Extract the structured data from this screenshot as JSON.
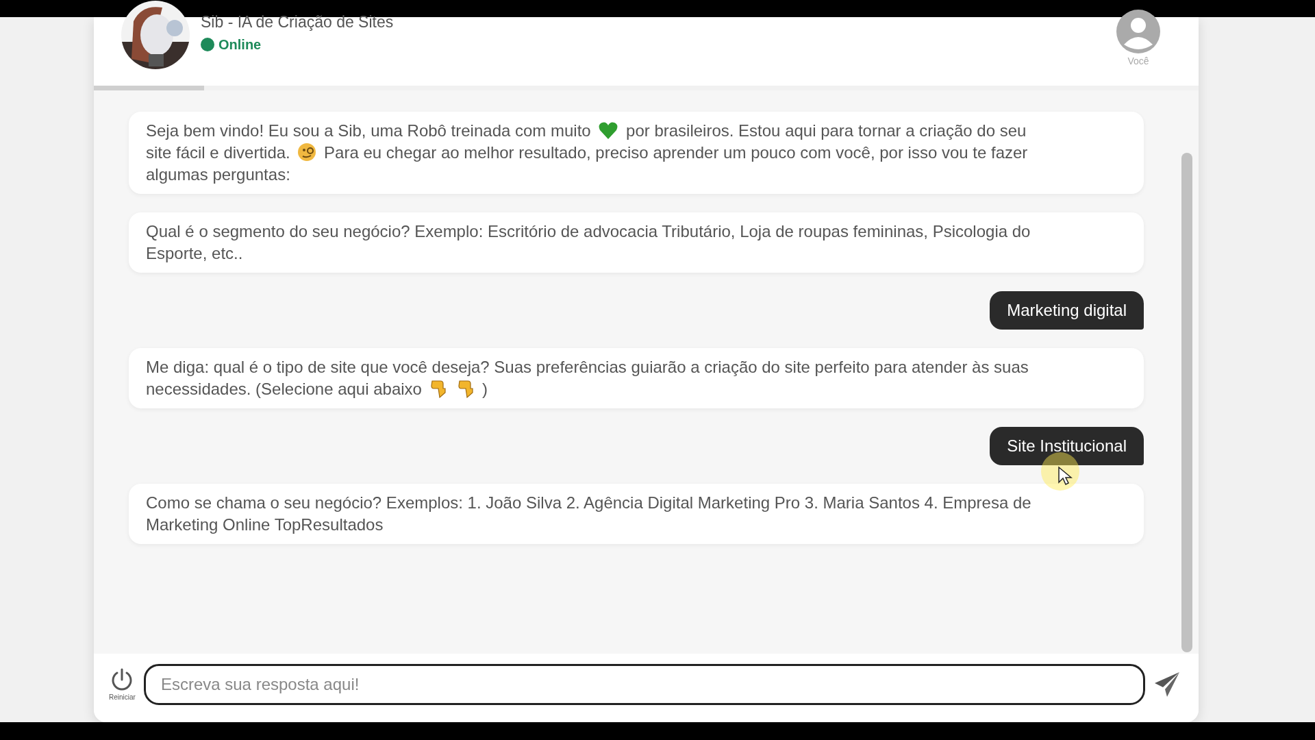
{
  "header": {
    "title": "Sib - IA de Criação de Sites",
    "status": "Online",
    "user_label": "Você"
  },
  "progress": {
    "level": 0.1
  },
  "messages": [
    {
      "kind": "bot",
      "parts": [
        {
          "kind": "text",
          "text": "Seja bem vindo! Eu sou a Sib, uma Robô treinada com muito"
        },
        {
          "kind": "heart"
        },
        {
          "kind": "text",
          "text": "por brasileiros. Estou aqui para tornar a criação do seu"
        },
        {
          "kind": "text",
          "text": "site fácil e divertida."
        },
        {
          "kind": "face"
        },
        {
          "kind": "text",
          "text": "Para eu chegar ao melhor resultado, preciso aprender um pouco com você, por isso vou te fazer"
        },
        {
          "kind": "text",
          "text": "algumas perguntas:"
        }
      ]
    },
    {
      "kind": "bot",
      "parts": [
        {
          "kind": "text",
          "text": "Qual é o segmento do seu negócio? Exemplo: Escritório de advocacia Tributário, Loja de roupas femininas, Psicologia do"
        },
        {
          "kind": "text",
          "text": "Esporte, etc.."
        }
      ]
    },
    {
      "kind": "user",
      "parts": [
        {
          "kind": "text",
          "text": "Marketing digital"
        }
      ]
    },
    {
      "kind": "bot",
      "parts": [
        {
          "kind": "text",
          "text": "Me diga: qual é o tipo de site que você deseja? Suas preferências guiarão a criação do site perfeito para atender às suas"
        },
        {
          "kind": "text",
          "text": "necessidades. (Selecione aqui abaixo"
        },
        {
          "kind": "pointer"
        },
        {
          "kind": "pointer"
        },
        {
          "kind": "text",
          "text": ")"
        }
      ]
    },
    {
      "kind": "user",
      "parts": [
        {
          "kind": "text",
          "text": "Site Institucional"
        }
      ]
    },
    {
      "kind": "bot",
      "parts": [
        {
          "kind": "text",
          "text": "Como se chama o seu negócio? Exemplos: 1. João Silva 2. Agência Digital Marketing Pro 3. Maria Santos 4. Empresa de"
        },
        {
          "kind": "text",
          "text": "Marketing Online TopResultados"
        }
      ]
    }
  ],
  "composer": {
    "restart_label": "Reiniciar",
    "placeholder": "Escreva sua resposta aqui!"
  }
}
